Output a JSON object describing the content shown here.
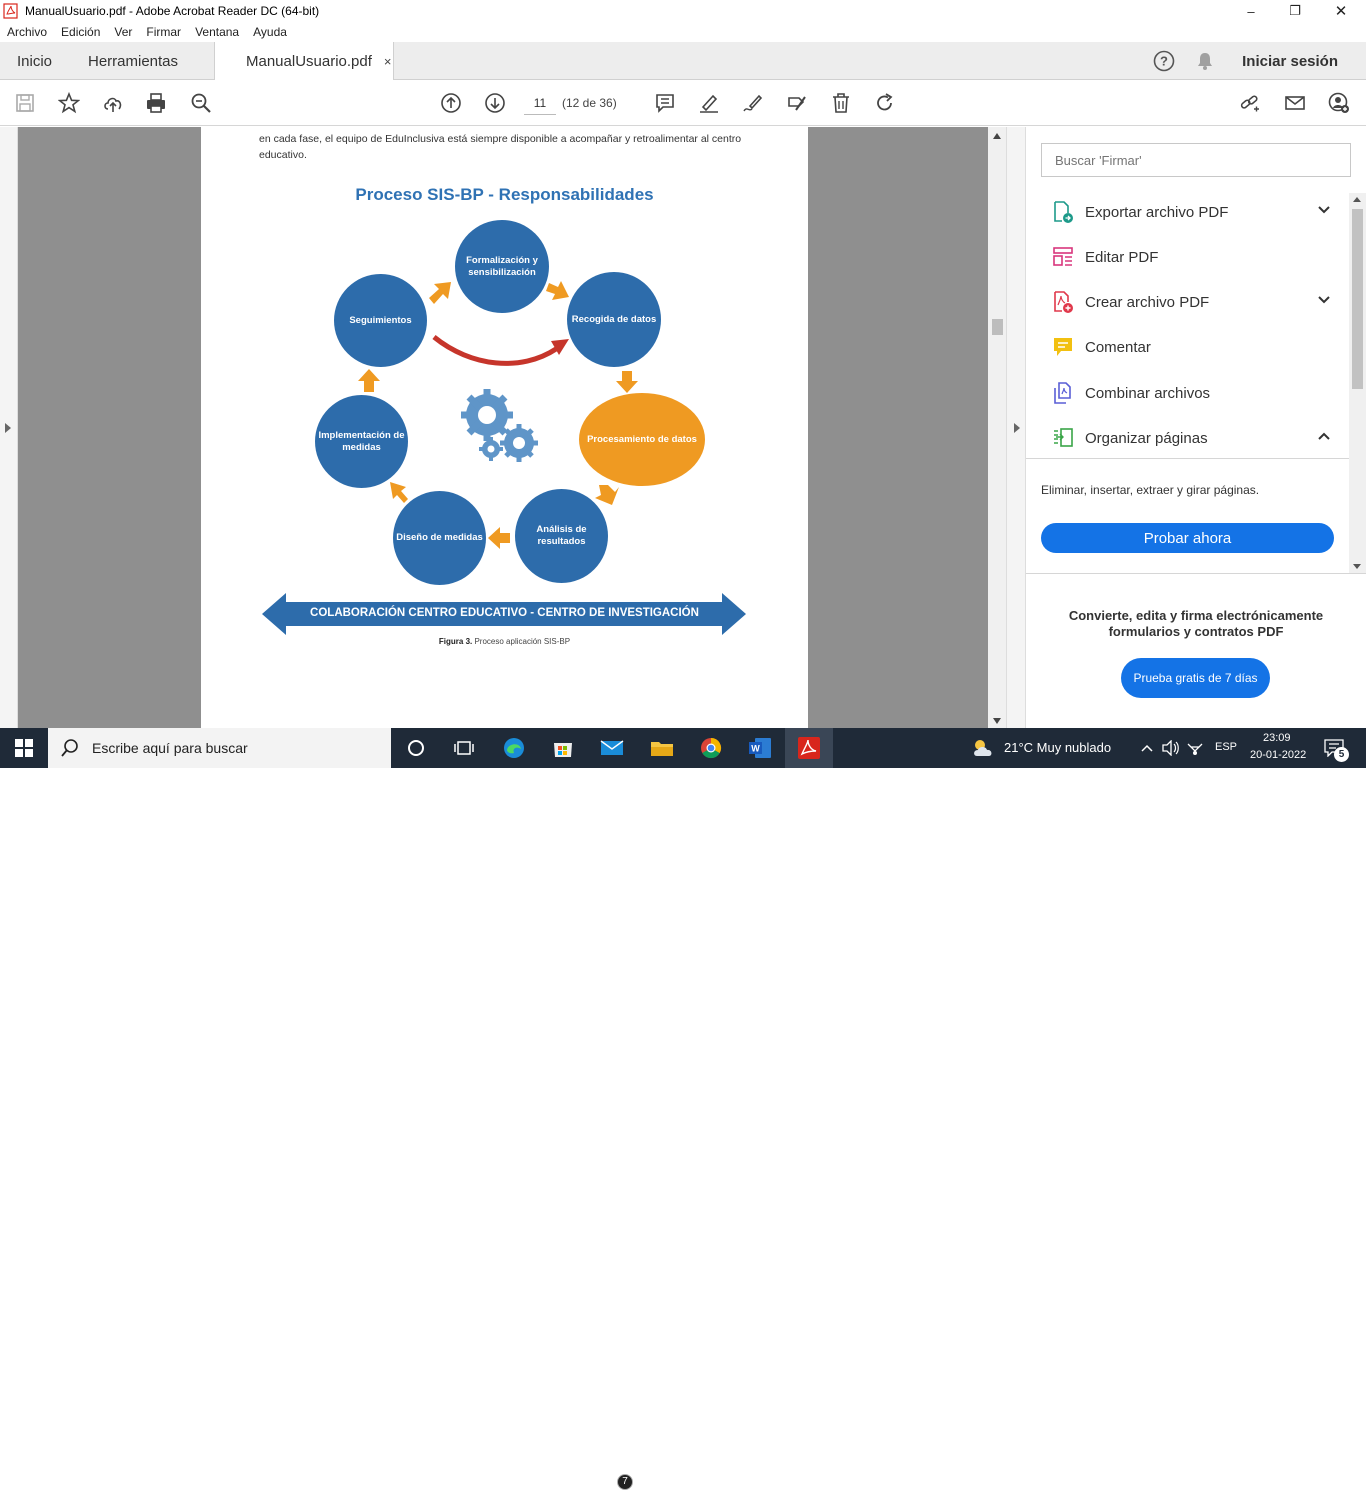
{
  "window": {
    "title": "ManualUsuario.pdf - Adobe Acrobat Reader DC (64-bit)",
    "minimize": "–",
    "maximize": "❐",
    "close": "✕"
  },
  "menu": [
    "Archivo",
    "Edición",
    "Ver",
    "Firmar",
    "Ventana",
    "Ayuda"
  ],
  "tabs": {
    "home": "Inicio",
    "tools": "Herramientas",
    "document": "ManualUsuario.pdf",
    "close": "×",
    "sign_in": "Iniciar sesión"
  },
  "toolbar": {
    "page_number": "11",
    "page_count": "(12 de 36)"
  },
  "document": {
    "intro_text": "en cada fase, el equipo de EduInclusiva está siempre disponible a acompañar y retroalimentar al centro educativo.",
    "diagram_title": "Proceso SIS-BP - Responsabilidades",
    "nodes": {
      "formalizacion": "Formalización y sensibilización",
      "recogida": "Recogida de datos",
      "procesamiento": "Procesamiento de datos",
      "analisis": "Análisis de resultados",
      "diseno": "Diseño de medidas",
      "implementacion": "Implementación de medidas",
      "seguimientos": "Seguimientos"
    },
    "banner": "COLABORACIÓN CENTRO EDUCATIVO - CENTRO DE INVESTIGACIÓN",
    "caption_label": "Figura 3.",
    "caption_text": " Proceso aplicación SIS-BP"
  },
  "panel": {
    "search_placeholder": "Buscar 'Firmar'",
    "tools": [
      {
        "label": "Exportar archivo PDF",
        "icon": "export-pdf-icon",
        "color": "#1d9a8a"
      },
      {
        "label": "Editar PDF",
        "icon": "edit-pdf-icon",
        "color": "#d9367d"
      },
      {
        "label": "Crear archivo PDF",
        "icon": "create-pdf-icon",
        "color": "#e0384b"
      },
      {
        "label": "Comentar",
        "icon": "comment-icon",
        "color": "#f2c010"
      },
      {
        "label": "Combinar archivos",
        "icon": "combine-files-icon",
        "color": "#5a5fd6"
      },
      {
        "label": "Organizar páginas",
        "icon": "organize-pages-icon",
        "color": "#3aa548"
      }
    ],
    "organize_desc": "Eliminar, insertar, extraer y girar páginas.",
    "try_now": "Probar ahora",
    "promo_text": "Convierte, edita y firma electrónicamente formularios y contratos PDF",
    "trial_button": "Prueba gratis de 7 días"
  },
  "taskbar": {
    "search_placeholder": "Escribe aquí para buscar",
    "weather": "21°C  Muy nublado",
    "language": "ESP",
    "time": "23:09",
    "date": "20-01-2022",
    "mail_badge": "7",
    "notification_count": "5"
  },
  "colors": {
    "accent": "#1473e6",
    "diagram_blue": "#2d6cab",
    "diagram_orange": "#ef9a22",
    "acrobat_red": "#d8261c"
  }
}
